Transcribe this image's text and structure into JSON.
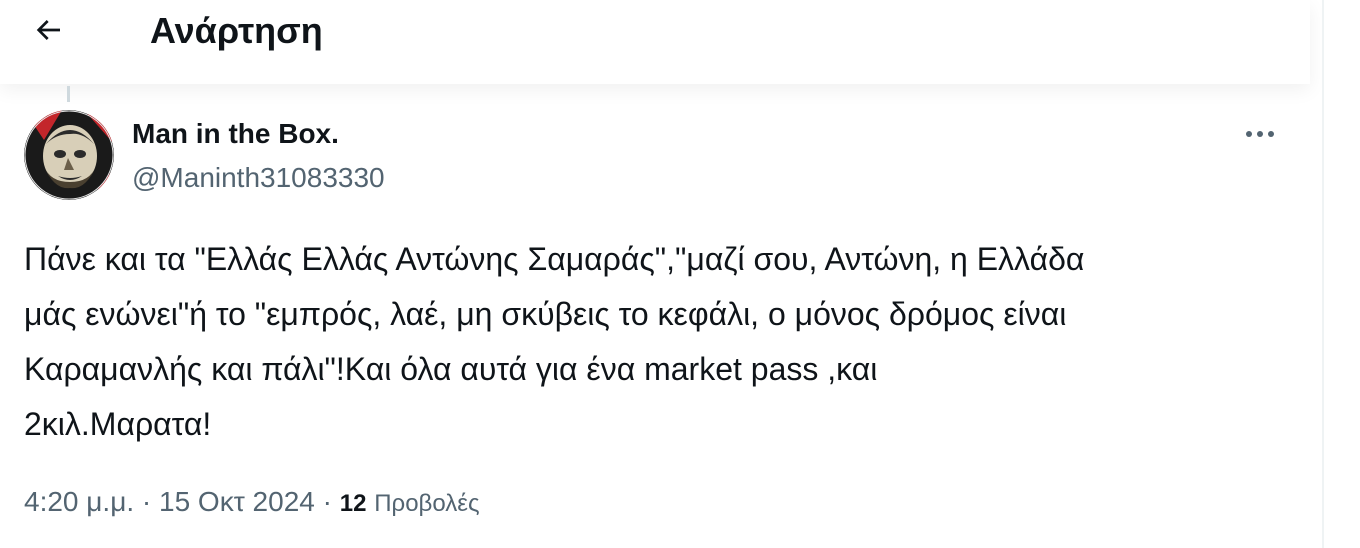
{
  "header": {
    "title": "Ανάρτηση",
    "back_icon": "arrow-left-icon"
  },
  "post": {
    "author": {
      "display_name": "Man in the Box.",
      "handle": "@Maninth31083330",
      "avatar_icon": "avatar-image"
    },
    "more_icon": "more-dots-icon",
    "text": "Πάνε και τα \"Ελλάς Ελλάς Αντώνης Σαμαράς\",\"μαζί σου, Αντώνη, η Ελλάδα\nμάς ενώνει\"ή το \"εμπρός, λαέ, μη σκύβεις το κεφάλι, ο μόνος δρόμος είναι\nΚαραμανλής και πάλι\"!Και όλα αυτά για ένα market pass ,και\n2κιλ.Μαρατα!",
    "time": "4:20 μ.μ.",
    "separator": "·",
    "date": "15 Οκτ 2024",
    "views_count": "12",
    "views_label": "Προβολές"
  },
  "colors": {
    "text_primary": "#0f1419",
    "text_secondary": "#536471",
    "border": "#eff3f4"
  }
}
